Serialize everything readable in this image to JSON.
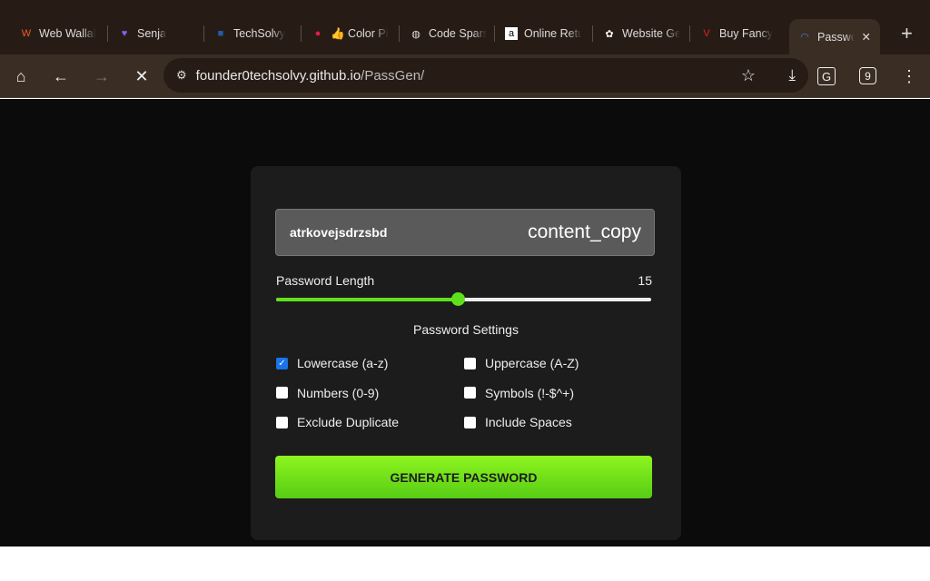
{
  "browser": {
    "tabs": [
      {
        "title": "Web Wallal",
        "icon": "w-logo-icon",
        "color": "#f05a28"
      },
      {
        "title": "Senja",
        "icon": "heart-icon",
        "color": "#8b5cf6"
      },
      {
        "title": "TechSolvy",
        "icon": "techsolvy-icon",
        "color": "#1e5fa8"
      },
      {
        "title": "👍 Color Pi",
        "icon": "color-picker-icon",
        "color": "#e11d48"
      },
      {
        "title": "Code Spars",
        "icon": "globe-icon",
        "color": "#ddd"
      },
      {
        "title": "Online Retu",
        "icon": "amazon-icon",
        "color": "#fff"
      },
      {
        "title": "Website Ge",
        "icon": "openai-icon",
        "color": "#fff"
      },
      {
        "title": "Buy Fancy",
        "icon": "vi-icon",
        "color": "#e11d26"
      },
      {
        "title": "Passwor",
        "icon": "loading-spinner-icon",
        "color": "#4a7de8",
        "active": true
      }
    ],
    "url": "founder0techsolvy.github.io/PassGen/",
    "url_host": "founder0techsolvy.github.io",
    "url_path": "/PassGen/"
  },
  "app": {
    "password": "atrkovejsdrzsbd",
    "copy_label": "content_copy",
    "length_label": "Password Length",
    "length_value": "15",
    "length_fraction": 0.485,
    "settings_title": "Password Settings",
    "options": [
      {
        "label": "Lowercase (a-z)",
        "checked": true
      },
      {
        "label": "Uppercase (A-Z)",
        "checked": false
      },
      {
        "label": "Numbers (0-9)",
        "checked": false
      },
      {
        "label": "Symbols (!-$^+)",
        "checked": false
      },
      {
        "label": "Exclude Duplicate",
        "checked": false
      },
      {
        "label": "Include Spaces",
        "checked": false
      }
    ],
    "generate_label": "GENERATE PASSWORD",
    "accent": "#5ee01d"
  }
}
